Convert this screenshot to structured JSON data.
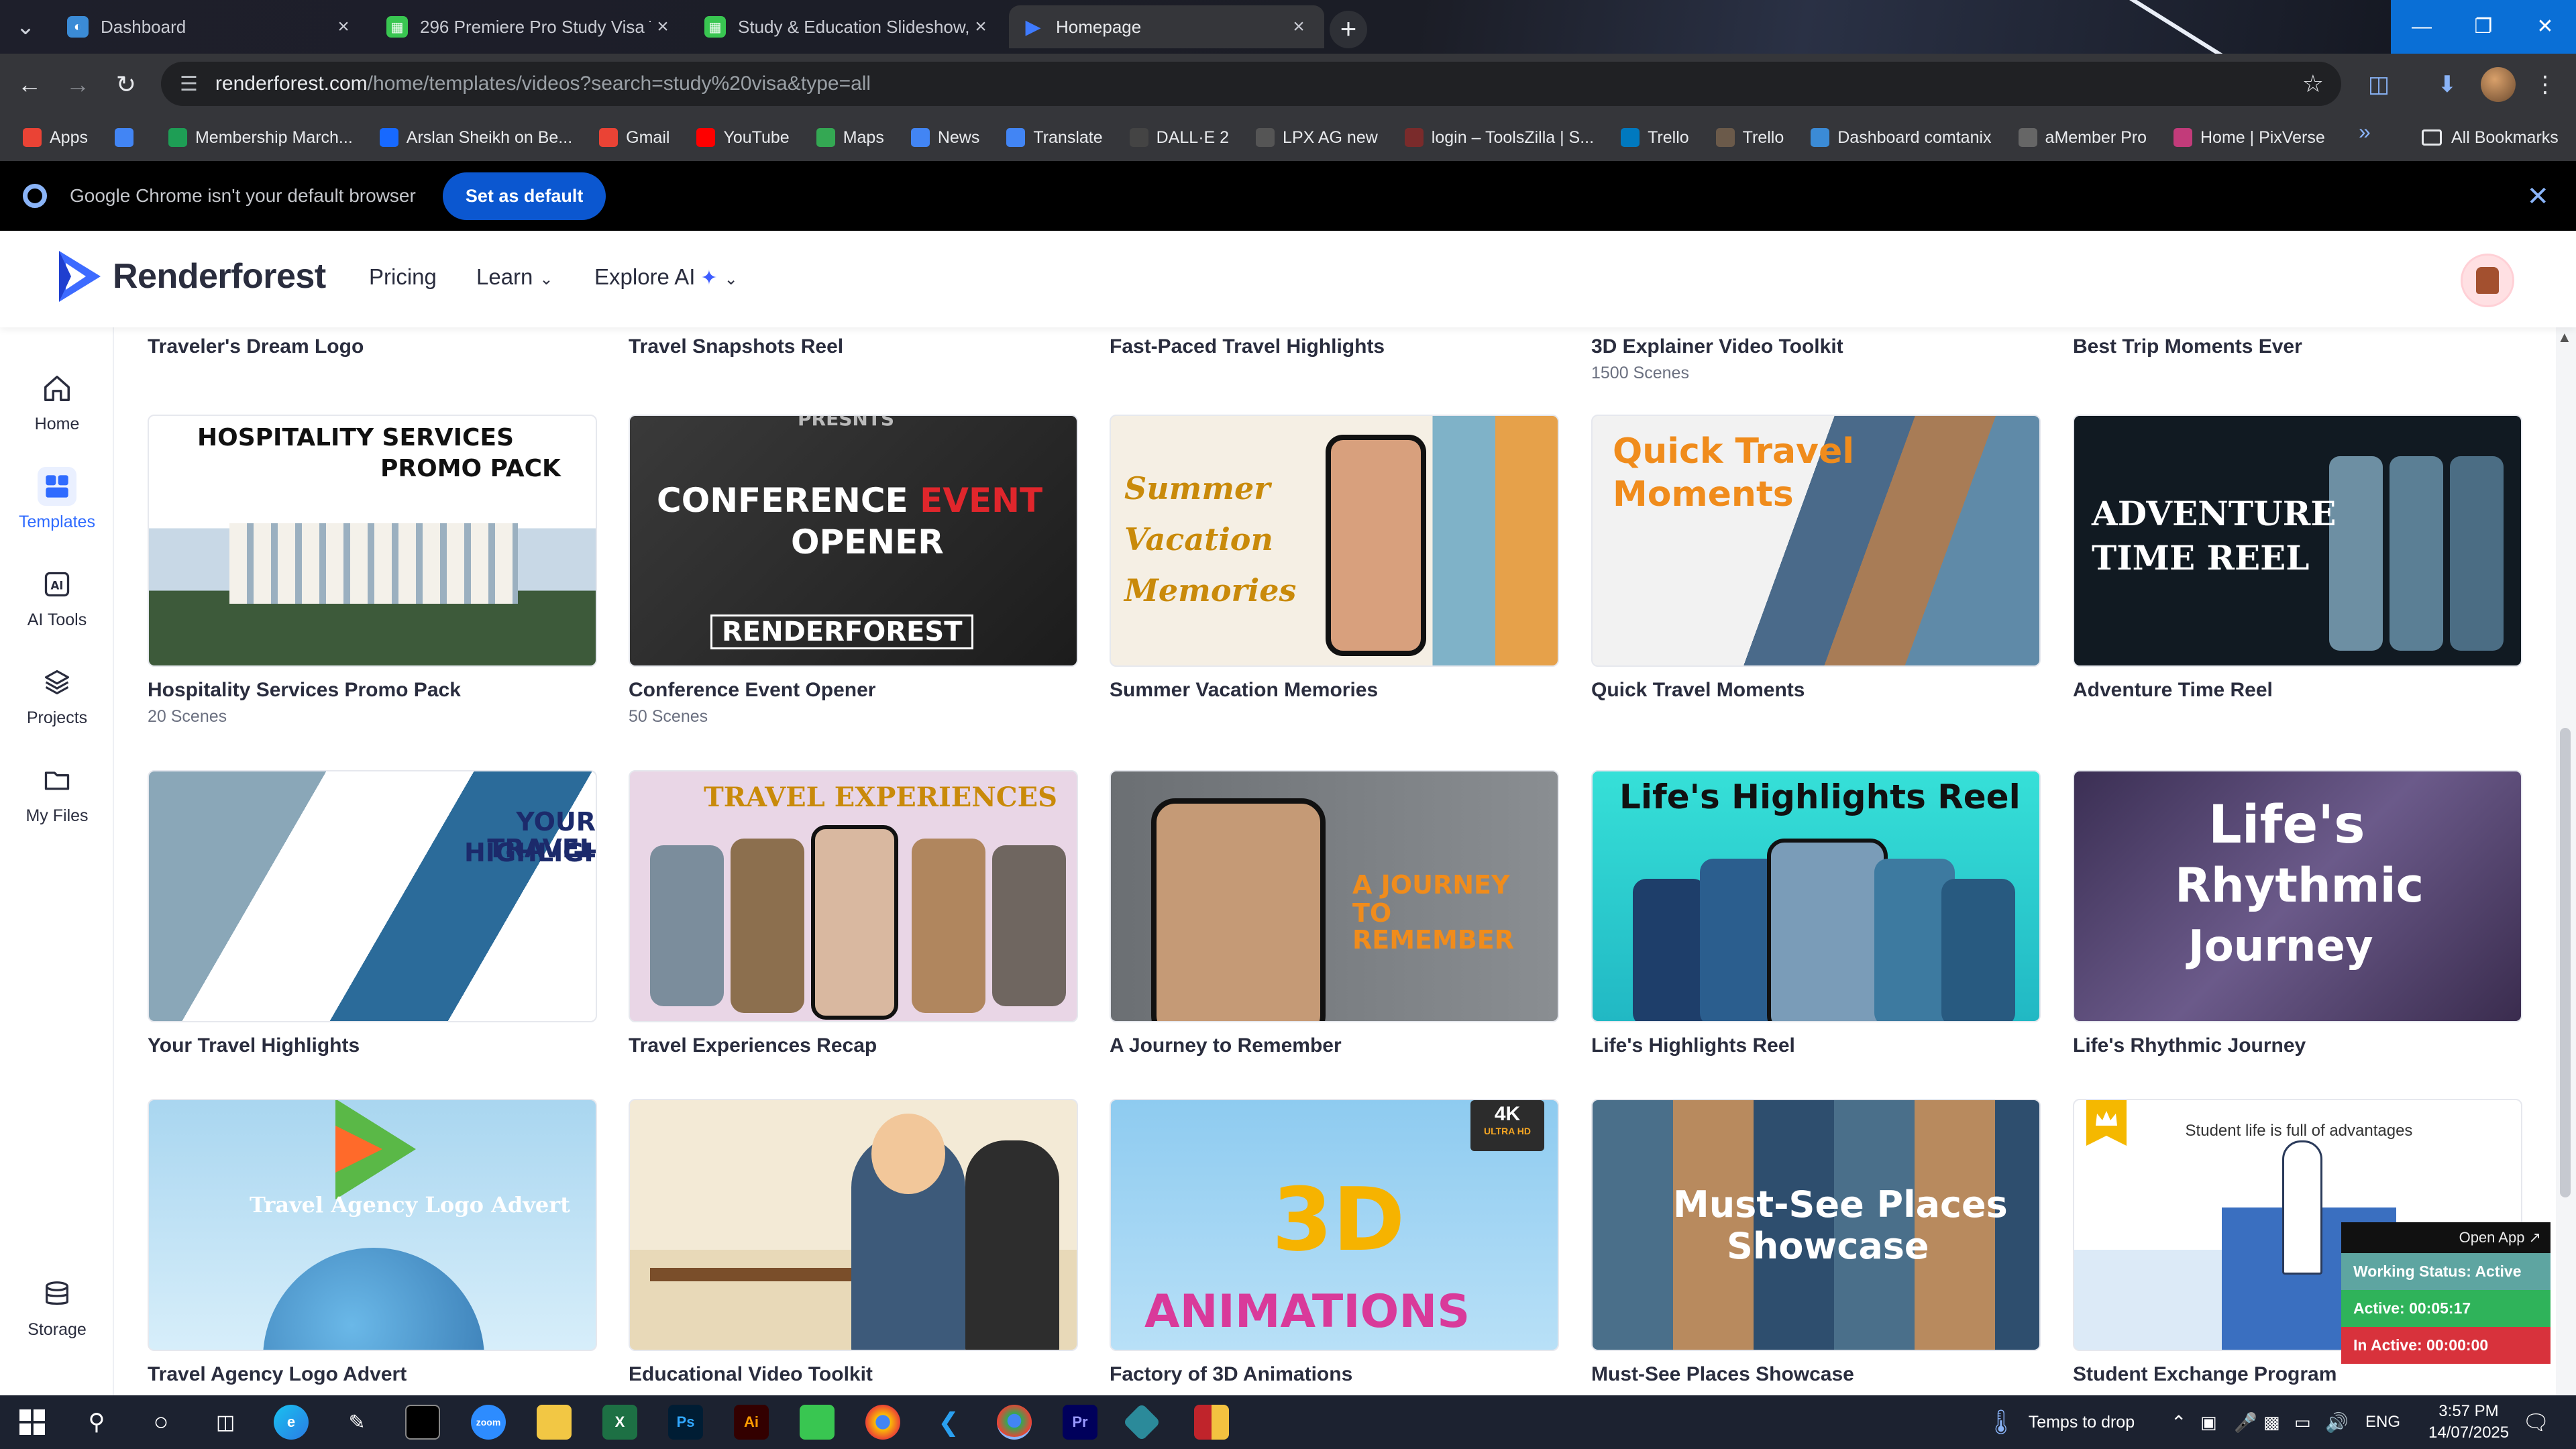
{
  "browser": {
    "tabs": [
      {
        "title": "Dashboard",
        "color": "#3b8bd6",
        "glyph": "◐"
      },
      {
        "title": "296 Premiere Pro Study Visa Te",
        "color": "#39c651",
        "glyph": "■"
      },
      {
        "title": "Study & Education Slideshow, V",
        "color": "#39c651",
        "glyph": "■"
      },
      {
        "title": "Homepage",
        "color": "#1f6bff",
        "glyph": "▶"
      }
    ],
    "new_tab_glyph": "+",
    "url": {
      "host": "renderforest.com",
      "path": "/home/templates/videos?search=study%20visa&type=all"
    },
    "bookmarks": [
      {
        "label": "Apps",
        "icon": "grid-icon",
        "color": "#ea4335"
      },
      {
        "label": "",
        "icon": "grid-icon",
        "color": "#4285f4"
      },
      {
        "label": "Membership March...",
        "icon": "bookmark-icon",
        "color": "#1e9e55"
      },
      {
        "label": "Arslan Sheikh on Be...",
        "icon": "behance-icon",
        "color": "#1769ff"
      },
      {
        "label": "Gmail",
        "icon": "gmail-icon",
        "color": "#ea4335"
      },
      {
        "label": "YouTube",
        "icon": "youtube-icon",
        "color": "#ff0000"
      },
      {
        "label": "Maps",
        "icon": "maps-icon",
        "color": "#34a853"
      },
      {
        "label": "News",
        "icon": "news-icon",
        "color": "#4285f4"
      },
      {
        "label": "Translate",
        "icon": "translate-icon",
        "color": "#4285f4"
      },
      {
        "label": "DALL·E 2",
        "icon": "openai-icon",
        "color": "#444"
      },
      {
        "label": "LPX AG new",
        "icon": "link-icon",
        "color": "#555"
      },
      {
        "label": "login – ToolsZilla | S...",
        "icon": "toolszilla-icon",
        "color": "#7a2b2b"
      },
      {
        "label": "Trello",
        "icon": "trello-icon",
        "color": "#0079bf"
      },
      {
        "label": "Trello",
        "icon": "trello-icon",
        "color": "#6b5a4a"
      },
      {
        "label": "Dashboard comtanix",
        "icon": "dashboard-icon",
        "color": "#3b8bd6"
      },
      {
        "label": "aMember Pro",
        "icon": "amember-icon",
        "color": "#666"
      },
      {
        "label": "Home | PixVerse",
        "icon": "pixverse-icon",
        "color": "#c23b7a"
      }
    ],
    "all_bookmarks": "All Bookmarks",
    "banner": {
      "message": "Google Chrome isn't your default browser",
      "button": "Set as default"
    }
  },
  "site": {
    "logo": "Renderforest",
    "nav": [
      {
        "label": "Pricing"
      },
      {
        "label": "Learn"
      },
      {
        "label": "Explore AI"
      }
    ],
    "sidebar": [
      {
        "label": "Home",
        "icon": "home-icon"
      },
      {
        "label": "Templates",
        "icon": "templates-icon"
      },
      {
        "label": "AI Tools",
        "icon": "ai-tools-icon"
      },
      {
        "label": "Projects",
        "icon": "projects-icon"
      },
      {
        "label": "My Files",
        "icon": "folder-icon"
      },
      {
        "label": "Storage",
        "icon": "storage-icon"
      }
    ],
    "previous_row": [
      {
        "name": "Traveler's Dream Logo",
        "scenes": ""
      },
      {
        "name": "Travel Snapshots Reel",
        "scenes": ""
      },
      {
        "name": "Fast-Paced Travel Highlights",
        "scenes": ""
      },
      {
        "name": "3D Explainer Video Toolkit",
        "scenes": "1500 Scenes"
      },
      {
        "name": "Best Trip Moments Ever",
        "scenes": ""
      }
    ],
    "templates": [
      {
        "name": "Hospitality Services Promo Pack",
        "scenes": "20 Scenes",
        "thumb_text": "HOSPITALITY SERVICES",
        "thumb_text2": "PROMO PACK"
      },
      {
        "name": "Conference Event Opener",
        "scenes": "50 Scenes",
        "thumb_text": "CONFERENCE",
        "thumb_text_accent": "EVENT",
        "thumb_text2": "OPENER",
        "thumb_small": "PRESNTS",
        "thumb_small2": "RENDERFOREST"
      },
      {
        "name": "Summer Vacation Memories",
        "scenes": "",
        "thumb_text": "Summer",
        "thumb_text2": "Vacation",
        "thumb_text3": "Memories"
      },
      {
        "name": "Quick Travel Moments",
        "scenes": "",
        "thumb_text": "Quick Travel",
        "thumb_text2": "Moments"
      },
      {
        "name": "Adventure Time Reel",
        "scenes": "",
        "thumb_text": "ADVENTURE",
        "thumb_text2": "TIME REEL"
      },
      {
        "name": "Your Travel Highlights",
        "scenes": "",
        "thumb_text": "YOUR TRAVEL",
        "thumb_text2": "HIGHLIGHTS"
      },
      {
        "name": "Travel Experiences Recap",
        "scenes": "",
        "thumb_text": "TRAVEL EXPERIENCES"
      },
      {
        "name": "A Journey to Remember",
        "scenes": "",
        "thumb_text": "A JOURNEY",
        "thumb_text2": "TO REMEMBER"
      },
      {
        "name": "Life's Highlights Reel",
        "scenes": "",
        "thumb_text": "Life's Highlights Reel"
      },
      {
        "name": "Life's Rhythmic Journey",
        "scenes": "",
        "thumb_text": "Life's",
        "thumb_text2": "Rhythmic",
        "thumb_text3": "Journey"
      },
      {
        "name": "Travel Agency Logo Advert",
        "scenes": "",
        "thumb_text": "Travel Agency Logo Advert"
      },
      {
        "name": "Educational Video Toolkit",
        "scenes": "",
        "thumb_text": ""
      },
      {
        "name": "Factory of 3D Animations",
        "scenes": "",
        "thumb_text": "3D",
        "thumb_text2": "ANIMATIONS",
        "badge": "4K",
        "badge_sub": "ULTRA HD"
      },
      {
        "name": "Must-See Places Showcase",
        "scenes": "",
        "thumb_text": "Must-See Places",
        "thumb_text2": "Showcase"
      },
      {
        "name": "Student Exchange Program",
        "scenes": "",
        "thumb_text": "Student life is full of advantages"
      }
    ],
    "widget": {
      "open_app": "Open App ↗",
      "working": "Working Status: Active",
      "active": "Active: 00:05:17",
      "inactive": "In Active: 00:00:00"
    }
  },
  "taskbar": {
    "weather": "Temps to drop",
    "lang": "ENG",
    "time": "3:57 PM",
    "date": "14/07/2025"
  }
}
